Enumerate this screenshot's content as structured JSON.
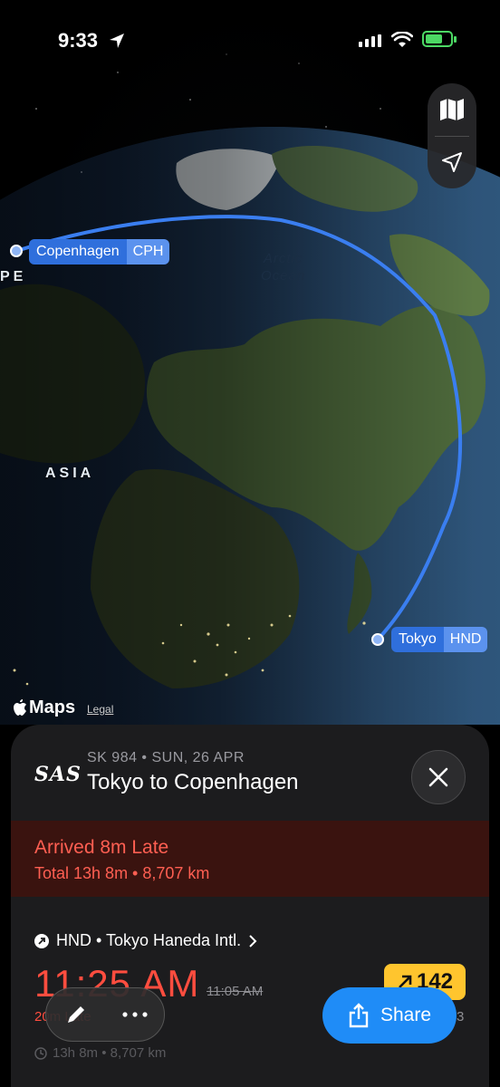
{
  "status_bar": {
    "time": "9:33"
  },
  "map": {
    "region_label": "ASIA",
    "edge_label": "PE",
    "ocean_line1": "Arctic",
    "ocean_line2": "Ocean",
    "origin": {
      "city": "Tokyo",
      "code": "HND"
    },
    "destination": {
      "city": "Copenhagen",
      "code": "CPH"
    },
    "attribution": "Maps",
    "legal": "Legal",
    "controls": [
      "map-icon",
      "location-arrow-icon"
    ]
  },
  "flight": {
    "airline": "SAS",
    "meta": "SK 984 • SUN, 26 APR",
    "title": "Tokyo to Copenhagen",
    "status": "Arrived 8m Late",
    "summary": "Total 13h 8m • 8,707 km",
    "departure": {
      "airport": "HND • Tokyo Haneda Intl.",
      "actual_time": "11:25 AM",
      "scheduled_time": "11:05 AM",
      "late_text": "20m Late",
      "gate_badge": "142",
      "right_peek": "3"
    },
    "duration_peek": "13h 8m • 8,707 km"
  },
  "toolbar": {
    "share_label": "Share"
  },
  "colors": {
    "route": "#3a7ef0",
    "late": "#ff5f52",
    "share": "#1f8cf7",
    "gate": "#ffc52e"
  }
}
